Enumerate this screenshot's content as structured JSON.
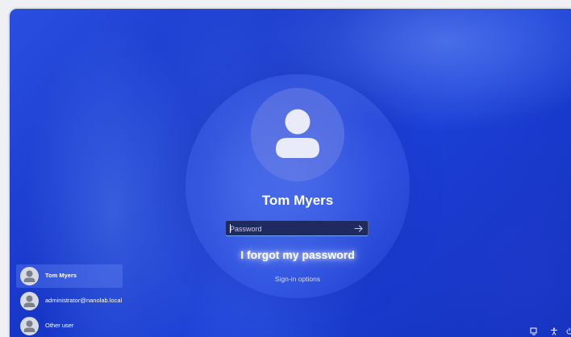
{
  "lock_screen": {
    "username": "Tom Myers",
    "password_placeholder": "Password",
    "forgot_password": "I forgot my password",
    "sign_in_options": "Sign-in options"
  },
  "users": [
    {
      "name": "Tom Myers",
      "selected": true
    },
    {
      "name": "administrator@nanolab.local",
      "selected": false
    },
    {
      "name": "Other user",
      "selected": false
    }
  ],
  "tray_icons": [
    "network-icon",
    "accessibility-icon",
    "power-icon"
  ],
  "colors": {
    "background": "#1a3bd0",
    "password_box": "#1f2a5e",
    "focus_underline": "#6fa7ff",
    "text": "#ffffff"
  }
}
